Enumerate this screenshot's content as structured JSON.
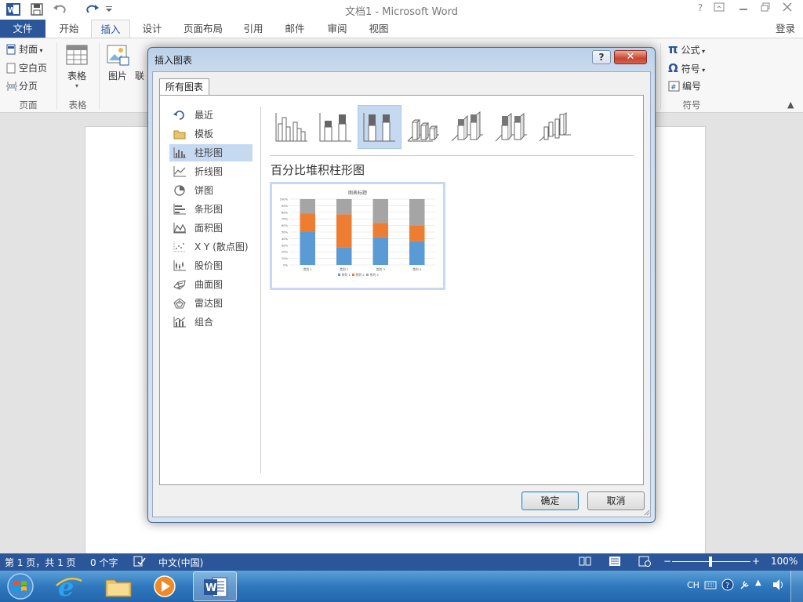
{
  "app": {
    "window_title": "文档1 - Microsoft Word",
    "login": "登录"
  },
  "tabs": [
    "文件",
    "开始",
    "插入",
    "设计",
    "页面布局",
    "引用",
    "邮件",
    "审阅",
    "视图"
  ],
  "ribbon": {
    "pages": {
      "cover": "封面",
      "blank_page": "空白页",
      "page_break": "分页",
      "group": "页面"
    },
    "tables": {
      "table": "表格",
      "group": "表格"
    },
    "illustrations": {
      "picture": "图片",
      "online": "联"
    },
    "symbols": {
      "equation": "公式",
      "symbol": "符号",
      "number": "编号",
      "group": "符号"
    }
  },
  "dialog": {
    "title": "插入图表",
    "help_label": "?",
    "tab_label": "所有图表",
    "categories": [
      "最近",
      "模板",
      "柱形图",
      "折线图",
      "饼图",
      "条形图",
      "面积图",
      "X Y (散点图)",
      "股价图",
      "曲面图",
      "雷达图",
      "组合"
    ],
    "selected_category": "柱形图",
    "subtype_icons": [
      "clustered-column-icon",
      "stacked-column-icon",
      "percent-stacked-column-icon",
      "3d-clustered-column-icon",
      "3d-stacked-column-icon",
      "3d-percent-stacked-column-icon",
      "3d-column-icon"
    ],
    "selected_subtype_index": 2,
    "chart_name": "百分比堆积柱形图",
    "ok_label": "确定",
    "cancel_label": "取消"
  },
  "chart_data": {
    "type": "bar",
    "stacked": "percent",
    "title": "图表标题",
    "categories": [
      "类别 1",
      "类别 2",
      "类别 3",
      "类别 4"
    ],
    "series": [
      {
        "name": "系列 1",
        "color": "#5b9bd5",
        "values": [
          50,
          27,
          42,
          36
        ]
      },
      {
        "name": "系列 2",
        "color": "#ed7d31",
        "values": [
          28,
          50,
          22,
          24
        ]
      },
      {
        "name": "系列 3",
        "color": "#a5a5a5",
        "values": [
          22,
          23,
          36,
          40
        ]
      }
    ],
    "yticks": [
      "0%",
      "10%",
      "20%",
      "30%",
      "40%",
      "50%",
      "60%",
      "70%",
      "80%",
      "90%",
      "100%"
    ],
    "ylim": [
      0,
      100
    ],
    "legend": "bottom",
    "grid": true
  },
  "status": {
    "page": "第 1 页，共 1 页",
    "words": "0 个字",
    "language": "中文(中国)",
    "zoom": "100%"
  },
  "taskbar": {
    "ime": "CH",
    "apps": [
      "start-orb-icon",
      "internet-explorer-icon",
      "file-explorer-icon",
      "media-player-icon",
      "word-icon"
    ]
  }
}
